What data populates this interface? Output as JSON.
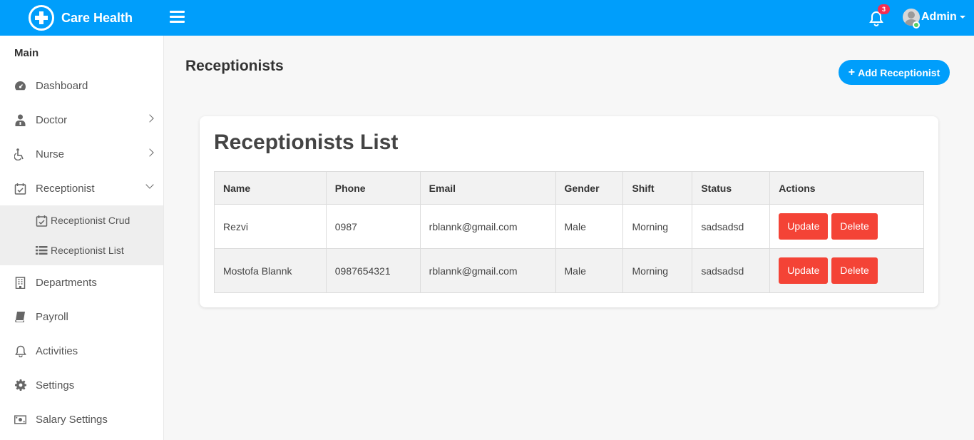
{
  "app": {
    "name": "Care Health"
  },
  "header": {
    "notification_count": "3",
    "user_name": "Admin"
  },
  "sidebar": {
    "title": "Main",
    "items": [
      {
        "label": "Dashboard",
        "icon": "dashboard-icon"
      },
      {
        "label": "Doctor",
        "icon": "doctor-icon"
      },
      {
        "label": "Nurse",
        "icon": "wheelchair-icon"
      },
      {
        "label": "Receptionist",
        "icon": "calendar-check-icon"
      },
      {
        "label": "Departments",
        "icon": "building-icon"
      },
      {
        "label": "Payroll",
        "icon": "book-icon"
      },
      {
        "label": "Activities",
        "icon": "bell-icon"
      },
      {
        "label": "Settings",
        "icon": "gear-icon"
      },
      {
        "label": "Salary Settings",
        "icon": "money-icon"
      }
    ],
    "submenu": [
      {
        "label": "Receptionist Crud",
        "icon": "calendar-check-icon"
      },
      {
        "label": "Receptionist List",
        "icon": "list-icon"
      }
    ]
  },
  "main": {
    "page_title": "Receptionists",
    "add_button": "Add Receptionist",
    "card_title": "Receptionists List",
    "columns": [
      "Name",
      "Phone",
      "Email",
      "Gender",
      "Shift",
      "Status",
      "Actions"
    ],
    "rows": [
      [
        "Rezvi",
        "0987",
        "rblannk@gmail.com",
        "Male",
        "Morning",
        "sadsadsd"
      ],
      [
        "Mostofa Blannk",
        "0987654321",
        "rblannk@gmail.com",
        "Male",
        "Morning",
        "sadsadsd"
      ]
    ],
    "update_label": "Update",
    "delete_label": "Delete"
  },
  "colors": {
    "primary": "#009efb",
    "danger": "#f44336",
    "badge": "#f62d51",
    "online": "#55ce63"
  }
}
